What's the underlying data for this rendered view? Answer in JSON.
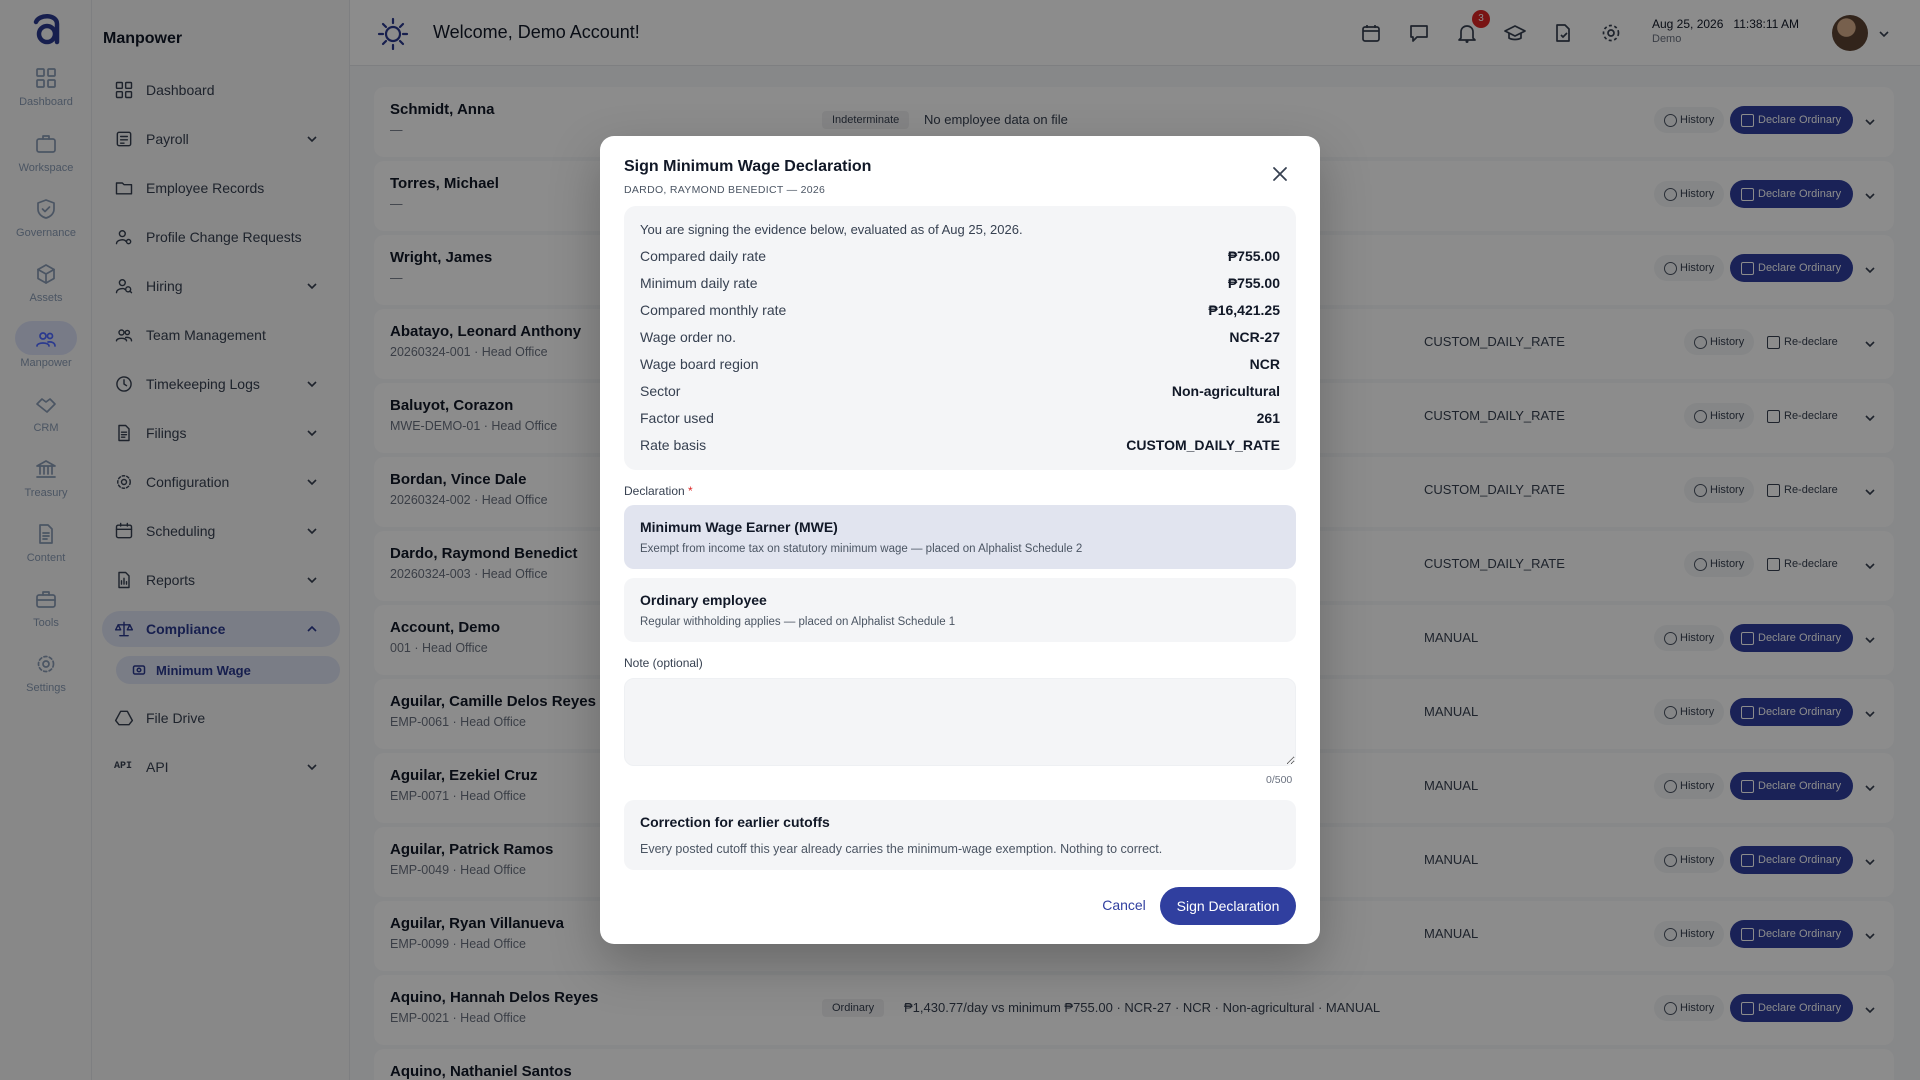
{
  "rail": {
    "items": [
      {
        "label": "Dashboard",
        "icon": "dashboard-icon"
      },
      {
        "label": "Workspace",
        "icon": "briefcase-icon"
      },
      {
        "label": "Governance",
        "icon": "shield-icon"
      },
      {
        "label": "Assets",
        "icon": "cube-icon"
      },
      {
        "label": "Manpower",
        "icon": "people-icon"
      },
      {
        "label": "CRM",
        "icon": "handshake-icon"
      },
      {
        "label": "Treasury",
        "icon": "bank-icon"
      },
      {
        "label": "Content",
        "icon": "document-icon"
      },
      {
        "label": "Tools",
        "icon": "toolbox-icon"
      },
      {
        "label": "Settings",
        "icon": "gear-icon"
      }
    ],
    "active": "Manpower"
  },
  "sidebar": {
    "title": "Manpower",
    "items": [
      {
        "label": "Dashboard",
        "icon": "dashboard-icon",
        "expandable": false
      },
      {
        "label": "Payroll",
        "icon": "payroll-icon",
        "expandable": true
      },
      {
        "label": "Employee Records",
        "icon": "folder-icon",
        "expandable": false
      },
      {
        "label": "Profile Change Requests",
        "icon": "user-gear-icon",
        "expandable": false
      },
      {
        "label": "Hiring",
        "icon": "user-search-icon",
        "expandable": true
      },
      {
        "label": "Team Management",
        "icon": "team-icon",
        "expandable": false
      },
      {
        "label": "Timekeeping Logs",
        "icon": "clock-icon",
        "expandable": true
      },
      {
        "label": "Filings",
        "icon": "file-icon",
        "expandable": true
      },
      {
        "label": "Configuration",
        "icon": "gear-icon",
        "expandable": true
      },
      {
        "label": "Scheduling",
        "icon": "calendar-icon",
        "expandable": true
      },
      {
        "label": "Reports",
        "icon": "report-icon",
        "expandable": true
      },
      {
        "label": "Compliance",
        "icon": "scale-icon",
        "expandable": true,
        "open": true
      },
      {
        "label": "File Drive",
        "icon": "drive-icon",
        "expandable": false
      },
      {
        "label": "API",
        "icon": "api-icon",
        "expandable": true
      }
    ],
    "compliance_sub": {
      "label": "Minimum Wage",
      "icon": "wage-icon"
    }
  },
  "topbar": {
    "title": "Welcome, Demo Account!",
    "notification_count": "3",
    "date": "Aug 25, 2026",
    "time": "11:38:11 AM",
    "user": "Demo",
    "api_label": "API"
  },
  "rows": [
    {
      "name": "Schmidt, Anna",
      "sub": "—",
      "tag": "Indeterminate",
      "evidence": "No employee data on file",
      "basis": "",
      "action": "Declare Ordinary",
      "primary": true
    },
    {
      "name": "Torres, Michael",
      "sub": "—",
      "tag": "",
      "evidence": "",
      "basis": "",
      "action": "Declare Ordinary",
      "primary": true
    },
    {
      "name": "Wright, James",
      "sub": "—",
      "tag": "",
      "evidence": "",
      "basis": "",
      "action": "Declare Ordinary",
      "primary": true
    },
    {
      "name": "Abatayo, Leonard Anthony",
      "sub": "20260324-001 · Head Office",
      "tag": "",
      "evidence": "",
      "basis": "CUSTOM_DAILY_RATE",
      "action": "Re-declare",
      "primary": false
    },
    {
      "name": "Baluyot, Corazon",
      "sub": "MWE-DEMO-01 · Head Office",
      "tag": "",
      "evidence": "",
      "basis": "CUSTOM_DAILY_RATE",
      "action": "Re-declare",
      "primary": false
    },
    {
      "name": "Bordan, Vince Dale",
      "sub": "20260324-002 · Head Office",
      "tag": "",
      "evidence": "",
      "basis": "CUSTOM_DAILY_RATE",
      "action": "Re-declare",
      "primary": false
    },
    {
      "name": "Dardo, Raymond Benedict",
      "sub": "20260324-003 · Head Office",
      "tag": "",
      "evidence": "",
      "basis": "CUSTOM_DAILY_RATE",
      "action": "Re-declare",
      "primary": false
    },
    {
      "name": "Account, Demo",
      "sub": "001 · Head Office",
      "tag": "",
      "evidence": "",
      "basis": "MANUAL",
      "action": "Declare Ordinary",
      "primary": true
    },
    {
      "name": "Aguilar, Camille Delos Reyes",
      "sub": "EMP-0061 · Head Office",
      "tag": "",
      "evidence": "",
      "basis": "MANUAL",
      "action": "Declare Ordinary",
      "primary": true
    },
    {
      "name": "Aguilar, Ezekiel Cruz",
      "sub": "EMP-0071 · Head Office",
      "tag": "",
      "evidence": "",
      "basis": "MANUAL",
      "action": "Declare Ordinary",
      "primary": true
    },
    {
      "name": "Aguilar, Patrick Ramos",
      "sub": "EMP-0049 · Head Office",
      "tag": "",
      "evidence": "",
      "basis": "MANUAL",
      "action": "Declare Ordinary",
      "primary": true
    },
    {
      "name": "Aguilar, Ryan Villanueva",
      "sub": "EMP-0099 · Head Office",
      "tag": "",
      "evidence": "",
      "basis": "MANUAL",
      "action": "Declare Ordinary",
      "primary": true
    },
    {
      "name": "Aquino, Hannah Delos Reyes",
      "sub": "EMP-0021 · Head Office",
      "tag": "Ordinary",
      "evidence": "₱1,430.77/day vs minimum ₱755.00 · NCR-27 · NCR · Non-agricultural · MANUAL",
      "basis": "",
      "action": "Declare Ordinary",
      "primary": true
    },
    {
      "name": "Aquino, Nathaniel Santos",
      "sub": "",
      "tag": "",
      "evidence": "",
      "basis": "",
      "action": "",
      "primary": true
    }
  ],
  "row_labels": {
    "history": "History"
  },
  "modal": {
    "title": "Sign Minimum Wage Declaration",
    "subtitle": "DARDO, RAYMOND BENEDICT — 2026",
    "intro": "You are signing the evidence below, evaluated as of Aug 25, 2026.",
    "evidence": [
      {
        "label": "Compared daily rate",
        "value": "₱755.00"
      },
      {
        "label": "Minimum daily rate",
        "value": "₱755.00"
      },
      {
        "label": "Compared monthly rate",
        "value": "₱16,421.25"
      },
      {
        "label": "Wage order no.",
        "value": "NCR-27"
      },
      {
        "label": "Wage board region",
        "value": "NCR"
      },
      {
        "label": "Sector",
        "value": "Non-agricultural"
      },
      {
        "label": "Factor used",
        "value": "261"
      },
      {
        "label": "Rate basis",
        "value": "CUSTOM_DAILY_RATE"
      }
    ],
    "declaration_label": "Declaration",
    "required_mark": "*",
    "options": [
      {
        "title": "Minimum Wage Earner (MWE)",
        "desc": "Exempt from income tax on statutory minimum wage — placed on Alphalist Schedule 2",
        "selected": true
      },
      {
        "title": "Ordinary employee",
        "desc": "Regular withholding applies — placed on Alphalist Schedule 1",
        "selected": false
      }
    ],
    "note_label": "Note (optional)",
    "note_value": "",
    "note_count": "0/500",
    "correction_title": "Correction for earlier cutoffs",
    "correction_desc": "Every posted cutoff this year already carries the minimum-wage exemption. Nothing to correct.",
    "cancel_label": "Cancel",
    "sign_label": "Sign Declaration"
  },
  "colors": {
    "accent": "#303f9f",
    "badge": "#dc2626",
    "overlay": "rgba(0,0,0,0.45)"
  }
}
